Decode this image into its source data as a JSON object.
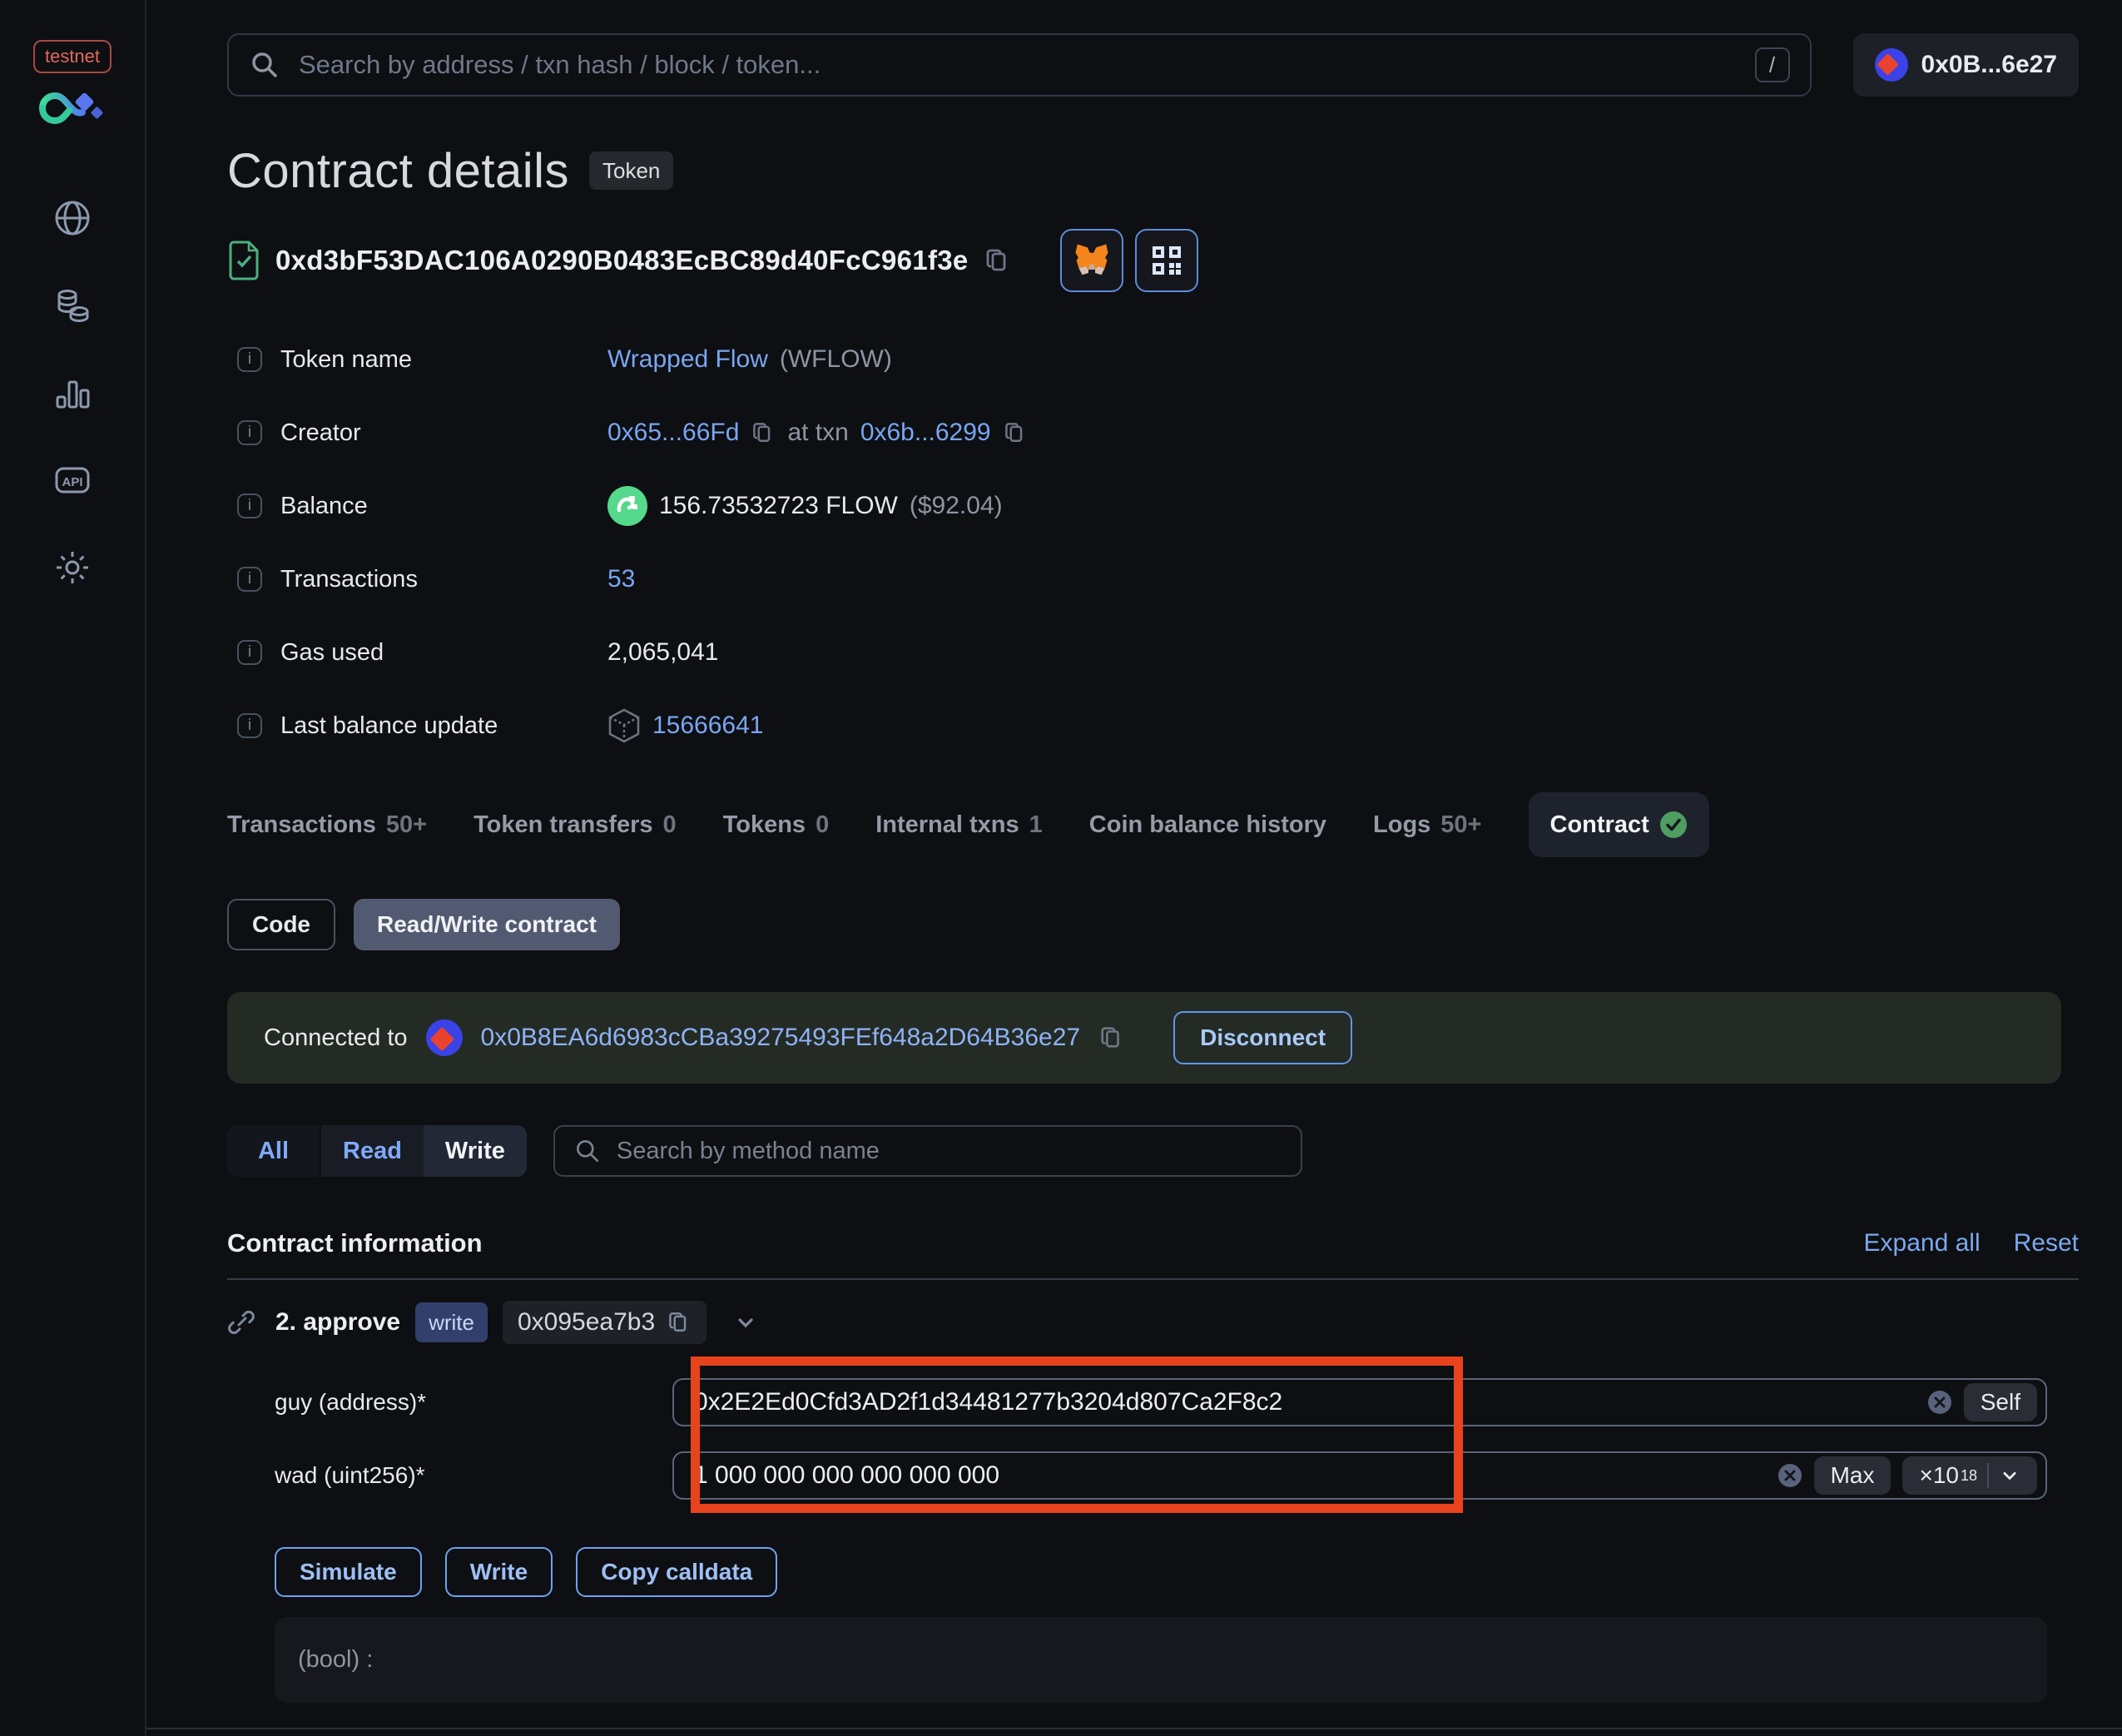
{
  "app": {
    "network_badge": "testnet",
    "account_label": "0x0B...6e27"
  },
  "topbar": {
    "search_placeholder": "Search by address / txn hash / block / token...",
    "shortcut_hint": "/"
  },
  "sidebar": {
    "icons": [
      "blockchain-logo",
      "globe",
      "tokens",
      "charts",
      "api",
      "settings"
    ]
  },
  "header": {
    "title": "Contract details",
    "badge": "Token",
    "address": "0xd3bF53DAC106A0290B0483EcBC89d40FcC961f3e"
  },
  "info_rows": [
    {
      "label": "Token name",
      "value_link": "Wrapped Flow",
      "value_suffix": "(WFLOW)"
    },
    {
      "label": "Creator",
      "creator": "0x65...66Fd",
      "at_txn_label": "at txn",
      "txn": "0x6b...6299"
    },
    {
      "label": "Balance",
      "value": "156.73532723 FLOW",
      "usd": "($92.04)"
    },
    {
      "label": "Transactions",
      "value": "53"
    },
    {
      "label": "Gas used",
      "value": "2,065,041"
    },
    {
      "label": "Last balance update",
      "value": "15666641"
    }
  ],
  "tabs": [
    {
      "label": "Transactions",
      "count": "50+"
    },
    {
      "label": "Token transfers",
      "count": "0"
    },
    {
      "label": "Tokens",
      "count": "0"
    },
    {
      "label": "Internal txns",
      "count": "1"
    },
    {
      "label": "Coin balance history",
      "count": ""
    },
    {
      "label": "Logs",
      "count": "50+"
    },
    {
      "label": "Contract",
      "count": ""
    }
  ],
  "subtabs": {
    "code": "Code",
    "read_write": "Read/Write contract"
  },
  "connected": {
    "prefix": "Connected to",
    "address": "0x0B8EA6d6983cCBa39275493FEf648a2D64B36e27",
    "disconnect": "Disconnect"
  },
  "filters": {
    "all": "All",
    "read": "Read",
    "write": "Write",
    "search_placeholder": "Search by method name"
  },
  "contract_info": {
    "heading": "Contract information",
    "expand_all": "Expand all",
    "reset": "Reset"
  },
  "method": {
    "index_name": "2. approve",
    "badge": "write",
    "selector": "0x095ea7b3"
  },
  "fields": [
    {
      "label": "guy (address)*",
      "value": "0x2E2Ed0Cfd3AD2f1d34481277b3204d807Ca2F8c2",
      "action": "Self"
    },
    {
      "label": "wad (uint256)*",
      "value": "1 000 000 000 000 000 000",
      "action": "Max",
      "multiplier_base": "×10",
      "multiplier_exp": "18"
    }
  ],
  "actions": {
    "simulate": "Simulate",
    "write": "Write",
    "copy_calldata": "Copy calldata"
  },
  "output": {
    "text": "(bool) :"
  },
  "colors": {
    "accent_blue": "#78a6f2",
    "success_green": "#4e9d61",
    "flow_green": "#55d98c",
    "write_badge_bg": "#333f6b",
    "connected_banner_bg": "#242b24",
    "annotation_red": "#E8431C"
  },
  "annotation": {
    "type": "highlight-box",
    "color": "#E8431C"
  }
}
